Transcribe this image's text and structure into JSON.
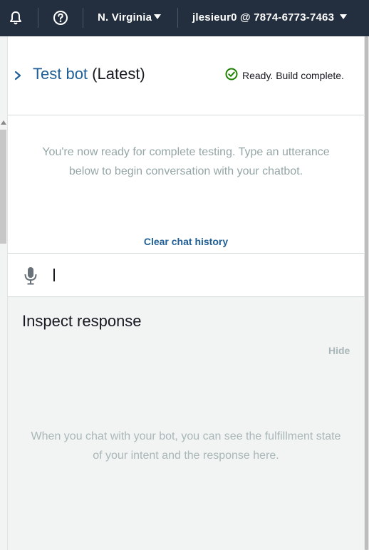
{
  "topnav": {
    "region": "N. Virginia",
    "account": "jlesieur0 @ 7874-6773-7463",
    "icons": [
      "bell-icon",
      "help-icon"
    ]
  },
  "panel": {
    "title_name": "Test bot",
    "title_suffix": "(Latest)",
    "status": "Ready. Build complete.",
    "chat_message": "You're now ready for complete testing. Type an utterance below to begin conversation with your chatbot.",
    "clear_label": "Clear chat history",
    "input_value": "",
    "inspect_title": "Inspect response",
    "hide_label": "Hide",
    "inspect_message": "When you chat with your bot, you can see the fulfillment state of your intent and the response here."
  },
  "colors": {
    "nav_bg": "#232f3e",
    "link": "#1f5f96",
    "success": "#1d8102",
    "muted": "#95a5a6"
  }
}
